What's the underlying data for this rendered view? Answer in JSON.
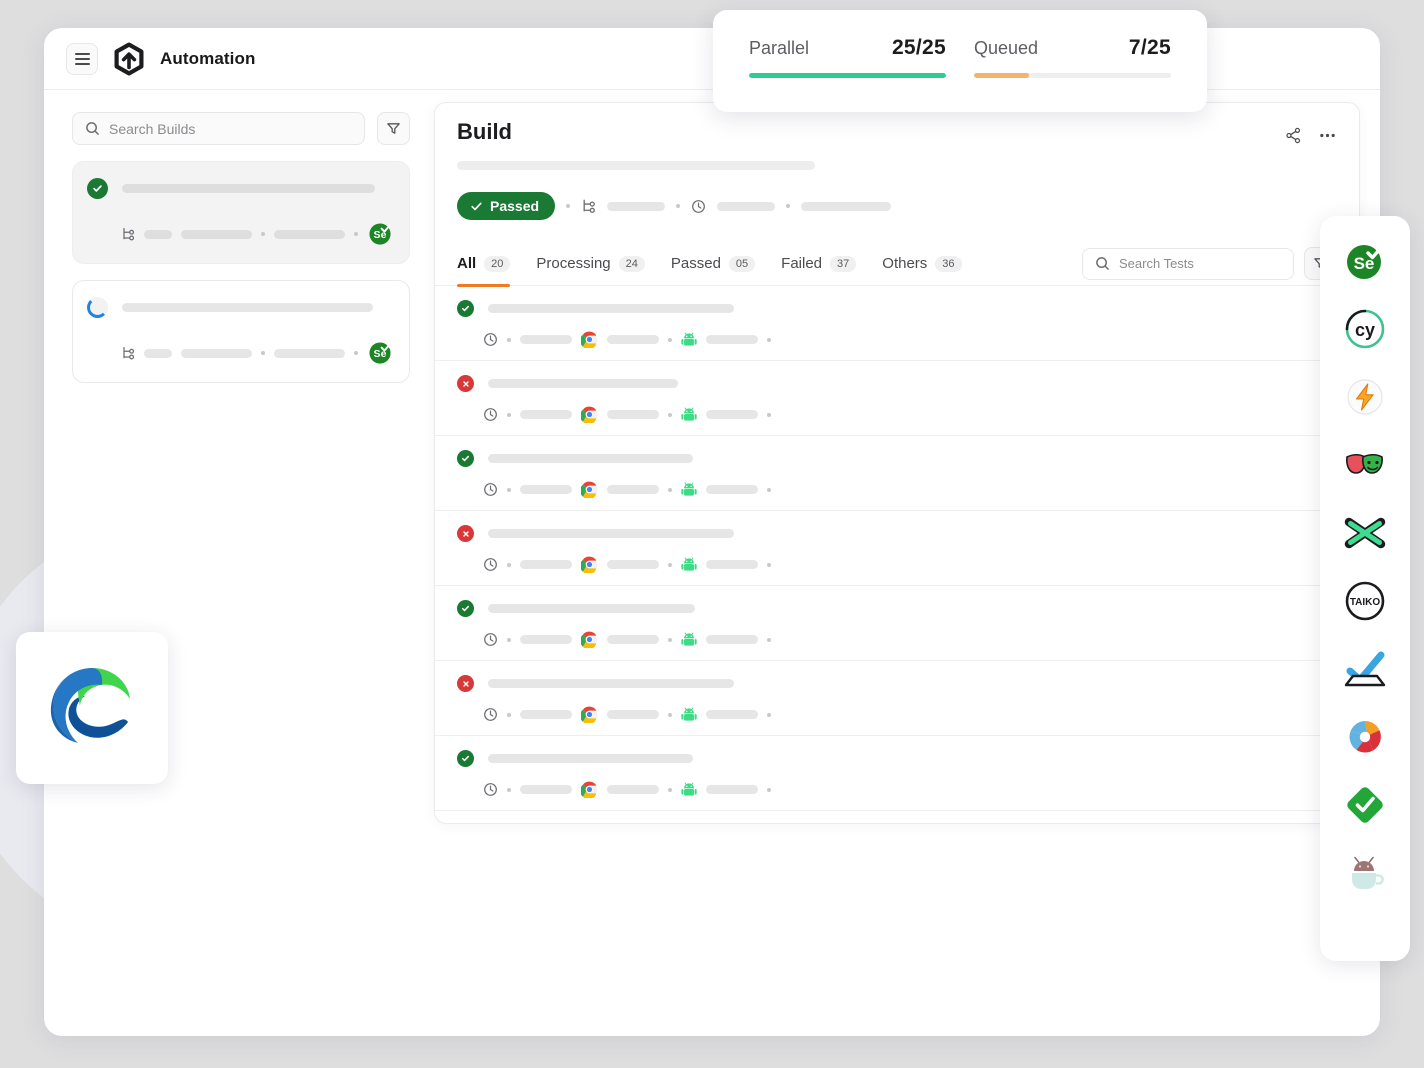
{
  "background_color": "#dededf",
  "header": {
    "menu_icon": "hamburger-icon",
    "logo_icon": "automation-hexagon-logo",
    "title": "Automation"
  },
  "sidebar": {
    "search": {
      "placeholder": "Search Builds",
      "icon": "search-icon"
    },
    "filter_icon": "filter-funnel-icon",
    "builds": [
      {
        "status": "passed",
        "status_icon": "check-circle-icon",
        "framework_icon": "selenium-icon",
        "selected": true,
        "title_skeleton_width": 253,
        "meta_skeletons": [
          30,
          75,
          75
        ]
      },
      {
        "status": "running",
        "status_icon": "spinner-icon",
        "framework_icon": "selenium-icon",
        "selected": false,
        "title_skeleton_width": 251,
        "meta_skeletons": [
          30,
          75,
          75
        ]
      }
    ]
  },
  "popup": {
    "metrics": [
      {
        "label": "Parallel",
        "value": "25/25",
        "percent": 100,
        "color": "#2ecc8f"
      },
      {
        "label": "Queued",
        "value": "7/25",
        "percent": 28,
        "color": "#f5b26b"
      }
    ]
  },
  "main": {
    "title": "Build",
    "share_icon": "share-icon",
    "more_icon": "more-horizontal-icon",
    "status_badge": {
      "label": "Passed",
      "icon": "check-icon",
      "color": "#1a7a33"
    },
    "meta_icons": [
      "branch-icon",
      "clock-icon"
    ],
    "tabs": [
      {
        "label": "All",
        "count": "20",
        "active": true
      },
      {
        "label": "Processing",
        "count": "24",
        "active": false
      },
      {
        "label": "Passed",
        "count": "05",
        "active": false
      },
      {
        "label": "Failed",
        "count": "37",
        "active": false
      },
      {
        "label": "Others",
        "count": "36",
        "active": false
      }
    ],
    "active_tab_color": "#f07a23",
    "search": {
      "placeholder": "Search Tests",
      "icon": "search-icon"
    },
    "filter_icon": "filter-funnel-icon",
    "tests": [
      {
        "status": "passed",
        "status_icon": "check-circle-icon",
        "title_width": 246,
        "browser_icon": "chrome-icon",
        "os_icon": "android-icon"
      },
      {
        "status": "failed",
        "status_icon": "x-circle-icon",
        "title_width": 190,
        "browser_icon": "chrome-icon",
        "os_icon": "android-icon"
      },
      {
        "status": "passed",
        "status_icon": "check-circle-icon",
        "title_width": 205,
        "browser_icon": "chrome-icon",
        "os_icon": "android-icon"
      },
      {
        "status": "failed",
        "status_icon": "x-circle-icon",
        "title_width": 246,
        "browser_icon": "chrome-icon",
        "os_icon": "android-icon"
      },
      {
        "status": "passed",
        "status_icon": "check-circle-icon",
        "title_width": 207,
        "browser_icon": "chrome-icon",
        "os_icon": "android-icon"
      },
      {
        "status": "failed",
        "status_icon": "x-circle-icon",
        "title_width": 246,
        "browser_icon": "chrome-icon",
        "os_icon": "android-icon"
      },
      {
        "status": "passed",
        "status_icon": "check-circle-icon",
        "title_width": 205,
        "browser_icon": "chrome-icon",
        "os_icon": "android-icon"
      }
    ]
  },
  "frameworks": [
    {
      "name": "Selenium",
      "icon": "selenium-icon"
    },
    {
      "name": "Cypress",
      "icon": "cypress-icon"
    },
    {
      "name": "Playwright",
      "icon": "playwright-icon"
    },
    {
      "name": "Puppeteer",
      "icon": "puppeteer-masks-icon"
    },
    {
      "name": "Nightwatch",
      "icon": "nightwatch-x-icon"
    },
    {
      "name": "Taiko",
      "icon": "taiko-icon"
    },
    {
      "name": "TestCafe",
      "icon": "testcafe-check-icon"
    },
    {
      "name": "Appium",
      "icon": "appium-icon"
    },
    {
      "name": "Cucumber",
      "icon": "cucumber-diamond-icon"
    },
    {
      "name": "Espresso",
      "icon": "espresso-icon"
    }
  ],
  "floating_browser": {
    "name": "Microsoft Edge",
    "icon": "edge-icon"
  }
}
